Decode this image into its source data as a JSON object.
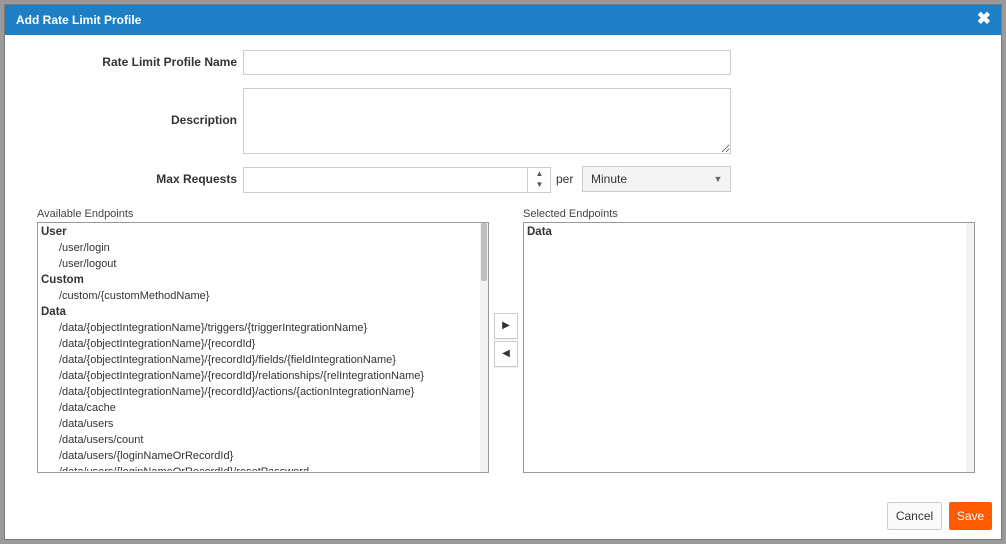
{
  "dialog": {
    "title": "Add Rate Limit Profile",
    "close_glyph": "✖"
  },
  "form": {
    "profile_name_label": "Rate Limit Profile Name",
    "profile_name_value": "",
    "description_label": "Description",
    "description_value": "",
    "max_requests_label": "Max Requests",
    "max_requests_value": "",
    "per_label": "per",
    "period_value": "Minute"
  },
  "available": {
    "label": "Available Endpoints",
    "rows": [
      {
        "kind": "group",
        "text": "User"
      },
      {
        "kind": "item",
        "text": "/user/login"
      },
      {
        "kind": "item",
        "text": "/user/logout"
      },
      {
        "kind": "group",
        "text": "Custom"
      },
      {
        "kind": "item",
        "text": "/custom/{customMethodName}"
      },
      {
        "kind": "group",
        "text": "Data"
      },
      {
        "kind": "item",
        "text": "/data/{objectIntegrationName}/triggers/{triggerIntegrationName}"
      },
      {
        "kind": "item",
        "text": "/data/{objectIntegrationName}/{recordId}"
      },
      {
        "kind": "item",
        "text": "/data/{objectIntegrationName}/{recordId}/fields/{fieldIntegrationName}"
      },
      {
        "kind": "item",
        "text": "/data/{objectIntegrationName}/{recordId}/relationships/{relIntegrationName}"
      },
      {
        "kind": "item",
        "text": "/data/{objectIntegrationName}/{recordId}/actions/{actionIntegrationName}"
      },
      {
        "kind": "item",
        "text": "/data/cache"
      },
      {
        "kind": "item",
        "text": "/data/users"
      },
      {
        "kind": "item",
        "text": "/data/users/count"
      },
      {
        "kind": "item",
        "text": "/data/users/{loginNameOrRecordId}"
      },
      {
        "kind": "item",
        "text": "/data/users/{loginNameOrRecordId}/resetPassword"
      }
    ]
  },
  "selected": {
    "label": "Selected Endpoints",
    "rows": [
      {
        "kind": "group",
        "text": "Data"
      }
    ]
  },
  "move": {
    "add_glyph": "▶",
    "remove_glyph": "◀"
  },
  "footer": {
    "cancel_label": "Cancel",
    "save_label": "Save"
  },
  "colors": {
    "titlebar": "#1e7fc4",
    "save": "#ff5a00"
  }
}
